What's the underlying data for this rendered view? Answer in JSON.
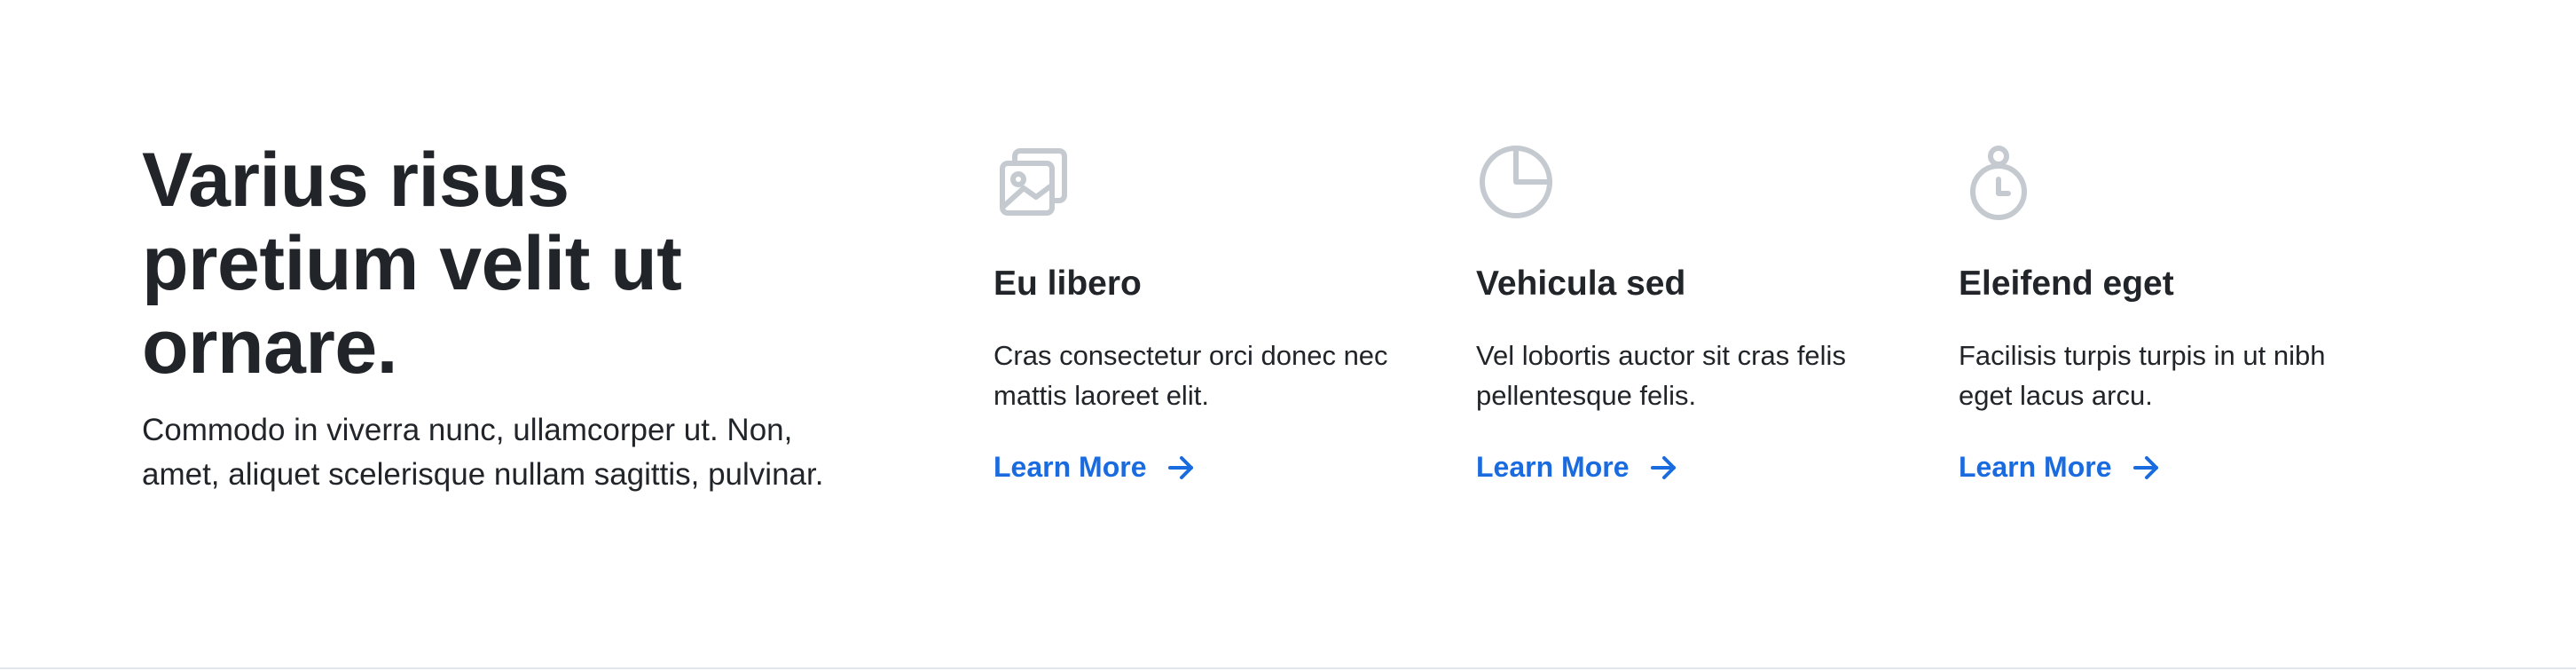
{
  "intro": {
    "title": "Varius risus pretium velit ut ornare.",
    "text": "Commodo in viverra nunc, ullamcorper ut. Non, amet, aliquet scelerisque nullam sagittis, pulvinar."
  },
  "features": [
    {
      "icon": "photos-icon",
      "title": "Eu libero",
      "text": "Cras consectetur orci donec nec mattis laoreet elit.",
      "link": "Learn More"
    },
    {
      "icon": "pie-chart-icon",
      "title": "Vehicula sed",
      "text": "Vel lobortis auctor sit cras felis pellentesque felis.",
      "link": "Learn More"
    },
    {
      "icon": "stopwatch-icon",
      "title": "Eleifend eget",
      "text": "Facilisis turpis turpis in ut nibh eget lacus arcu.",
      "link": "Learn More"
    }
  ],
  "colors": {
    "heading": "#212529",
    "link": "#1a6be0",
    "icon": "#c5cad1",
    "divider": "#e3e6ea"
  }
}
